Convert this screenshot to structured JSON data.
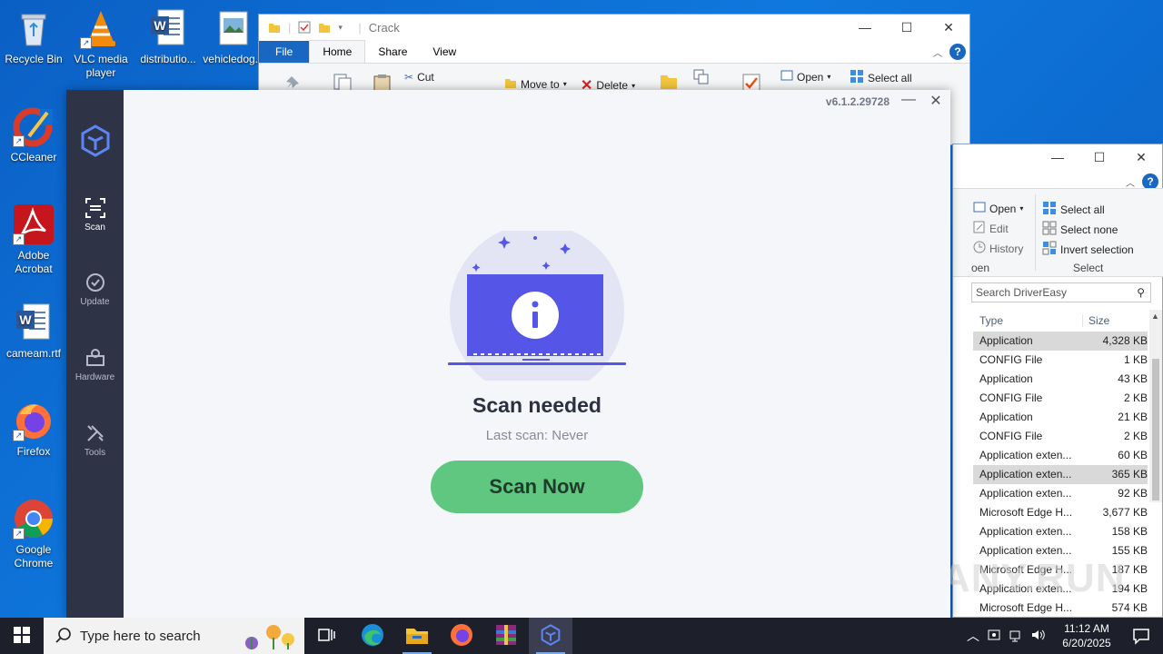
{
  "desktop": {
    "icons": [
      {
        "label": "Recycle Bin",
        "icon": "recycle-bin-icon"
      },
      {
        "label": "VLC media player",
        "icon": "vlc-icon"
      },
      {
        "label": "distributio...",
        "icon": "word-doc-icon"
      },
      {
        "label": "vehicledog...",
        "icon": "image-file-icon"
      },
      {
        "label": "CCleaner",
        "icon": "ccleaner-icon"
      },
      {
        "label": "Adobe Acrobat",
        "icon": "acrobat-icon"
      },
      {
        "label": "cameam.rtf",
        "icon": "word-doc-icon"
      },
      {
        "label": "Firefox",
        "icon": "firefox-icon"
      },
      {
        "label": "Google Chrome",
        "icon": "chrome-icon"
      }
    ]
  },
  "explorer_back": {
    "title": "Crack",
    "tabs": [
      "File",
      "Home",
      "Share",
      "View"
    ],
    "ribbon": {
      "cut": "Cut",
      "move_to": "Move to",
      "delete": "Delete",
      "open": "Open",
      "select_all": "Select all"
    }
  },
  "explorer_front": {
    "ribbon": {
      "open": "Open",
      "edit": "Edit",
      "history": "History",
      "open_group": "oen",
      "select_all": "Select all",
      "select_none": "Select none",
      "invert_selection": "Invert selection",
      "select_group": "Select"
    },
    "search_placeholder": "Search DriverEasy",
    "columns": {
      "type": "Type",
      "size": "Size"
    },
    "files": [
      {
        "type": "Application",
        "size": "4,328 KB",
        "selected": true
      },
      {
        "type": "CONFIG File",
        "size": "1 KB"
      },
      {
        "type": "Application",
        "size": "43 KB"
      },
      {
        "type": "CONFIG File",
        "size": "2 KB"
      },
      {
        "type": "Application",
        "size": "21 KB"
      },
      {
        "type": "CONFIG File",
        "size": "2 KB"
      },
      {
        "type": "Application exten...",
        "size": "60 KB"
      },
      {
        "type": "Application exten...",
        "size": "365 KB",
        "selected": true
      },
      {
        "type": "Application exten...",
        "size": "92 KB"
      },
      {
        "type": "Microsoft Edge H...",
        "size": "3,677 KB"
      },
      {
        "type": "Application exten...",
        "size": "158 KB"
      },
      {
        "type": "Application exten...",
        "size": "155 KB"
      },
      {
        "type": "Microsoft Edge H...",
        "size": "187 KB"
      },
      {
        "type": "Application exten...",
        "size": "194 KB"
      },
      {
        "type": "Microsoft Edge H...",
        "size": "574 KB"
      }
    ]
  },
  "drivereasy": {
    "version": "v6.1.2.29728",
    "nav": [
      {
        "label": "Scan",
        "icon": "scan-icon",
        "active": true
      },
      {
        "label": "Update",
        "icon": "update-icon"
      },
      {
        "label": "Hardware",
        "icon": "hardware-icon"
      },
      {
        "label": "Tools",
        "icon": "tools-icon"
      }
    ],
    "status_title": "Scan needed",
    "last_scan": "Last scan: Never",
    "scan_button": "Scan Now",
    "accent": "#5fc77f",
    "illustration_color": "#5556e8"
  },
  "taskbar": {
    "search_placeholder": "Type here to search",
    "apps": [
      "task-view-icon",
      "edge-icon",
      "file-explorer-icon",
      "firefox-icon",
      "winrar-icon",
      "drivereasy-icon"
    ],
    "time": "11:12 AM",
    "date": "6/20/2025"
  },
  "watermark": "ANY.RUN"
}
